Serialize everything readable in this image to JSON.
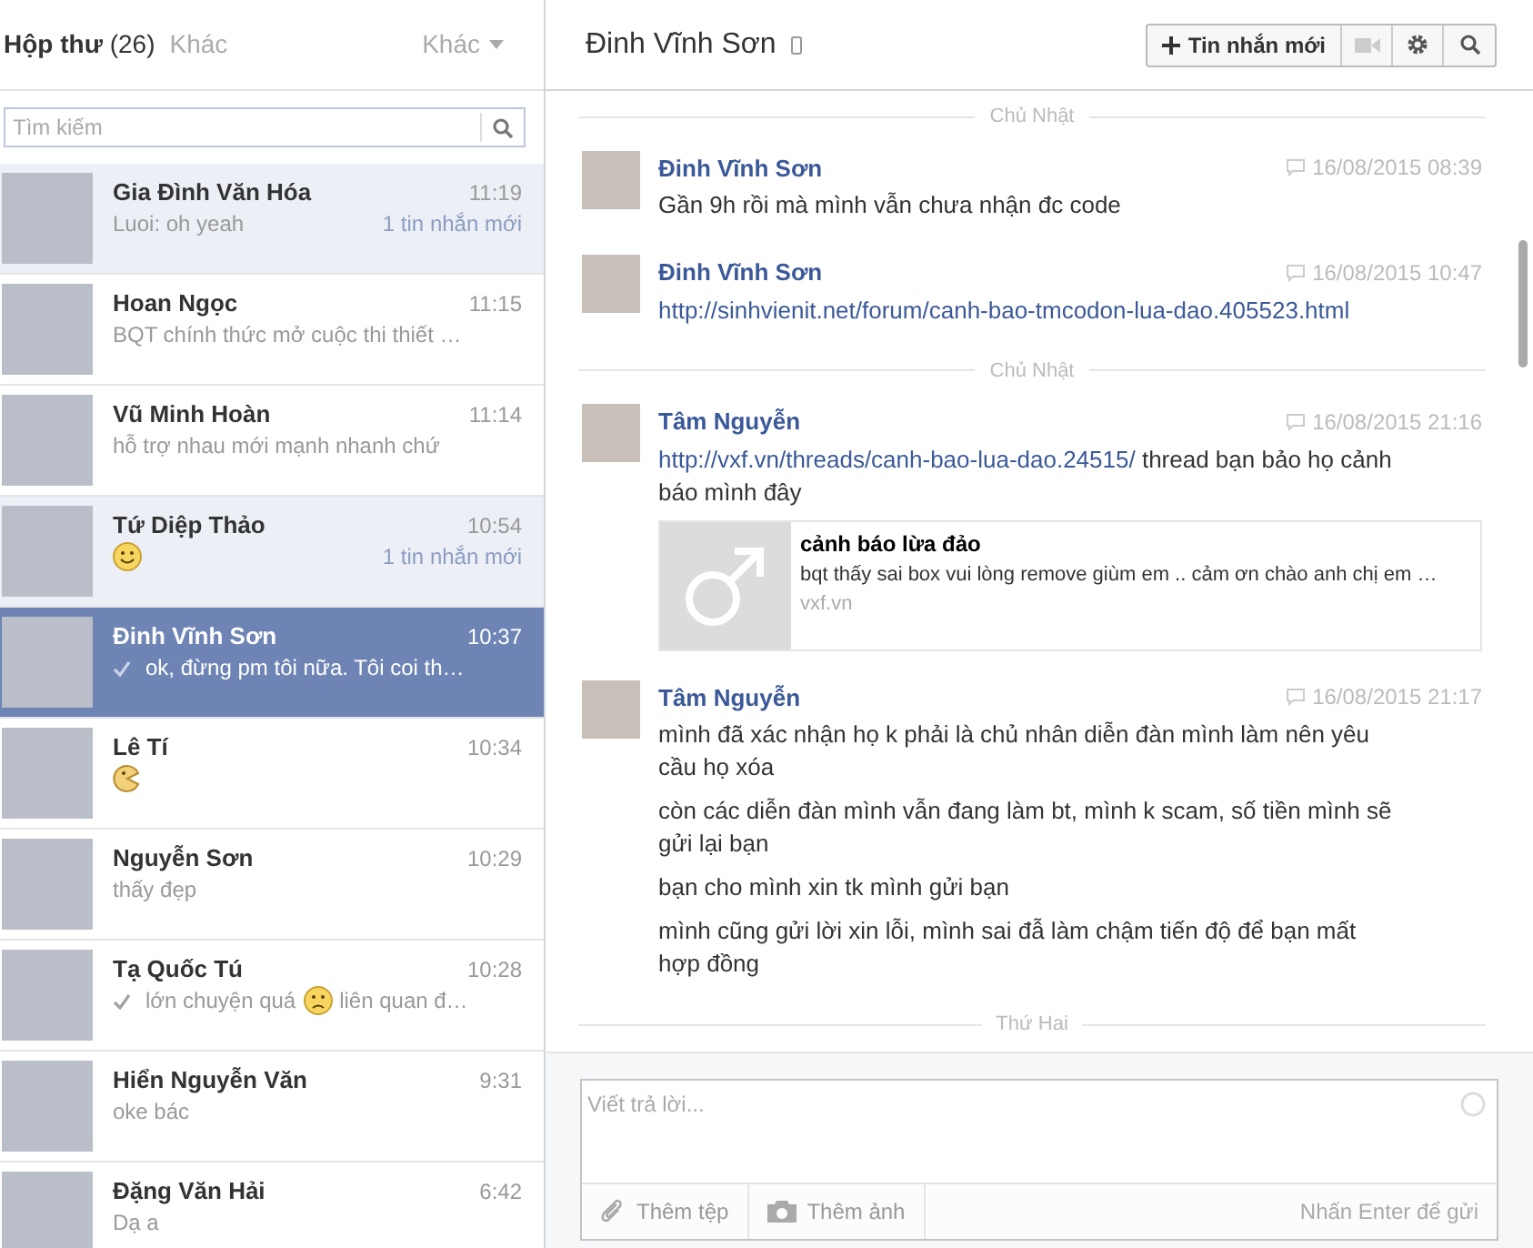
{
  "sidebar": {
    "tabs": [
      {
        "label": "Hộp thư",
        "count": "(26)",
        "selected": true
      },
      {
        "label": "Khác",
        "selected": false
      }
    ],
    "menu": {
      "label": "Khác"
    },
    "search": {
      "placeholder": "Tìm kiếm"
    },
    "conversations": [
      {
        "name": "Gia Đình Văn Hóa",
        "time": "11:19",
        "unread": true,
        "replied": false,
        "selected": false,
        "badge": "1 tin nhắn mới",
        "preview": [
          {
            "kind": "text",
            "text": "Luoi: oh yeah"
          }
        ]
      },
      {
        "name": "Hoan Ngọc",
        "time": "11:15",
        "unread": false,
        "replied": false,
        "selected": false,
        "preview": [
          {
            "kind": "text",
            "text": "BQT chính thức mở cuộc thi thiết …"
          }
        ]
      },
      {
        "name": "Vũ Minh Hoàn",
        "time": "11:14",
        "unread": false,
        "replied": false,
        "selected": false,
        "preview": [
          {
            "kind": "text",
            "text": "hỗ trợ nhau mới mạnh nhanh chứ"
          }
        ]
      },
      {
        "name": "Tứ Diệp Thảo",
        "time": "10:54",
        "unread": true,
        "replied": false,
        "selected": false,
        "badge": "1 tin nhắn mới",
        "preview": [
          {
            "kind": "smile"
          }
        ]
      },
      {
        "name": "Đinh Vĩnh Sơn",
        "time": "10:37",
        "unread": false,
        "replied": true,
        "selected": true,
        "preview": [
          {
            "kind": "text",
            "text": "ok, đừng pm tôi nữa. Tôi coi th…"
          }
        ]
      },
      {
        "name": "Lê Tí",
        "time": "10:34",
        "unread": false,
        "replied": false,
        "selected": false,
        "preview": [
          {
            "kind": "pacman"
          }
        ]
      },
      {
        "name": "Nguyễn Sơn",
        "time": "10:29",
        "unread": false,
        "replied": false,
        "selected": false,
        "preview": [
          {
            "kind": "text",
            "text": "thấy đẹp"
          }
        ]
      },
      {
        "name": "Tạ Quốc Tú",
        "time": "10:28",
        "unread": false,
        "replied": true,
        "selected": false,
        "preview": [
          {
            "kind": "text",
            "text": "lớn chuyện quá"
          },
          {
            "kind": "frown"
          },
          {
            "kind": "text",
            "text": "liên quan đ…"
          }
        ]
      },
      {
        "name": "Hiển Nguyễn Văn",
        "time": "9:31",
        "unread": false,
        "replied": false,
        "selected": false,
        "preview": [
          {
            "kind": "text",
            "text": "oke bác"
          }
        ]
      },
      {
        "name": "Đặng Văn Hải",
        "time": "6:42",
        "unread": false,
        "replied": false,
        "selected": false,
        "preview": [
          {
            "kind": "text",
            "text": "Dạ a"
          }
        ]
      }
    ]
  },
  "conversation": {
    "title": "Đinh Vĩnh Sơn",
    "new_message_button": "Tin nhắn mới",
    "timeline": [
      {
        "kind": "divider",
        "label": "Chủ Nhật"
      },
      {
        "kind": "message",
        "author": "Đinh Vĩnh Sơn",
        "time": "16/08/2015 08:39",
        "paragraphs": [
          [
            {
              "kind": "text",
              "text": "Gần 9h rồi mà mình vẫn chưa nhận đc code"
            }
          ]
        ]
      },
      {
        "kind": "message",
        "author": "Đinh Vĩnh Sơn",
        "time": "16/08/2015 10:47",
        "paragraphs": [
          [
            {
              "kind": "link",
              "text": "http://sinhvienit.net/forum/canh-bao-tmcodon-lua-dao.405523.html"
            }
          ]
        ]
      },
      {
        "kind": "divider",
        "label": "Chủ Nhật"
      },
      {
        "kind": "message",
        "author": "Tâm Nguyễn",
        "time": "16/08/2015 21:16",
        "paragraphs": [
          [
            {
              "kind": "link",
              "text": "http://vxf.vn/threads/canh-bao-lua-dao.24515/"
            },
            {
              "kind": "text",
              "text": " thread bạn bảo họ cảnh báo mình đây"
            }
          ]
        ],
        "attachment": {
          "title": "cảnh báo lừa đảo",
          "description": "bqt thấy sai box vui lòng remove giùm em .. cảm ơn chào anh chị em …",
          "domain": "vxf.vn"
        }
      },
      {
        "kind": "message",
        "author": "Tâm Nguyễn",
        "time": "16/08/2015 21:17",
        "paragraphs": [
          [
            {
              "kind": "text",
              "text": "mình đã xác nhận họ k phải là chủ nhân diễn đàn mình làm nên yêu cầu họ xóa"
            }
          ],
          [
            {
              "kind": "text",
              "text": "còn các diễn đàn mình vẫn đang làm bt, mình k scam, số tiền mình sẽ gửi lại bạn"
            }
          ],
          [
            {
              "kind": "text",
              "text": "bạn cho mình xin tk mình gửi bạn"
            }
          ],
          [
            {
              "kind": "text",
              "text": "mình cũng gửi lời xin lỗi, mình sai đẫ làm chậm tiến độ để bạn mất hợp đồng"
            }
          ]
        ]
      },
      {
        "kind": "divider",
        "label": "Thứ Hai"
      }
    ],
    "composer": {
      "placeholder": "Viết trả lời...",
      "attach_file": "Thêm tệp",
      "attach_photo": "Thêm ảnh",
      "enter_hint": "Nhấn Enter để gửi"
    }
  }
}
